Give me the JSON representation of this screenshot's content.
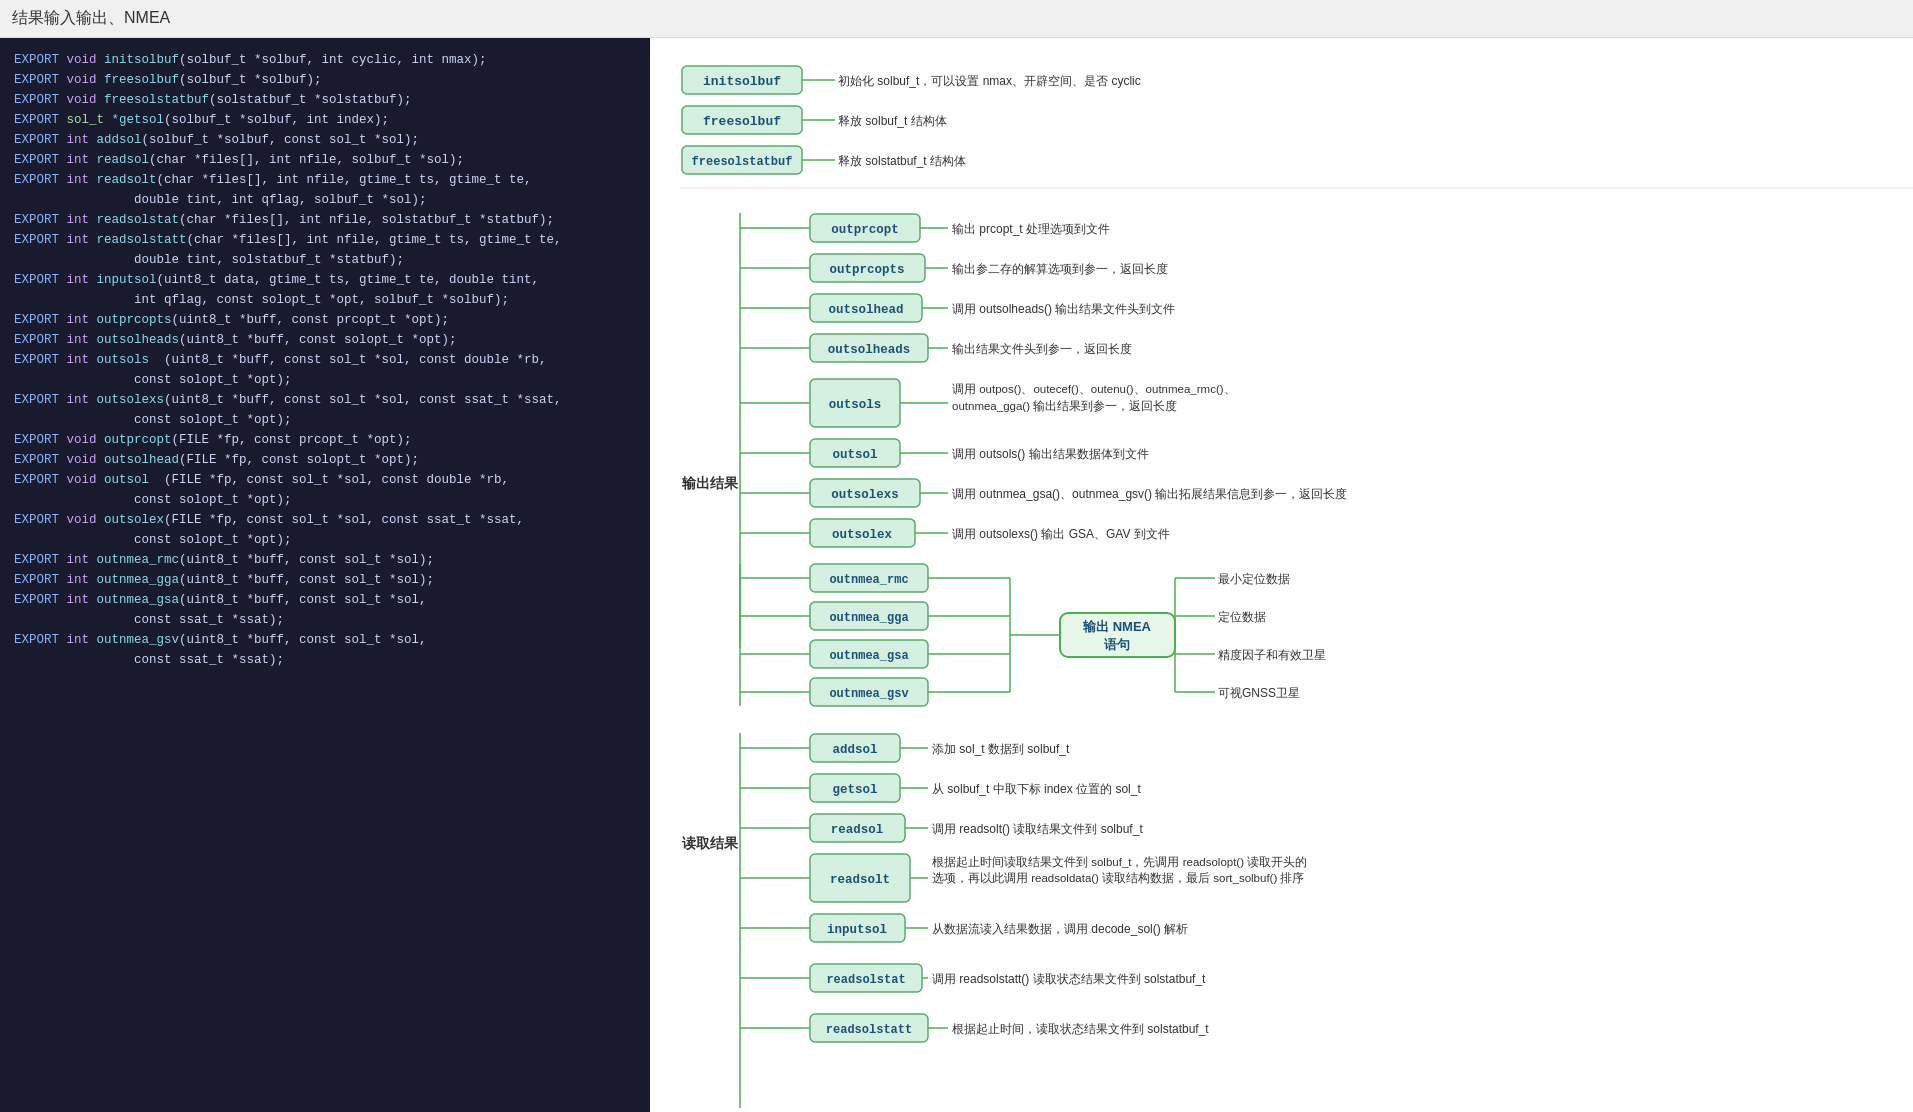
{
  "title": "结果输入输出、NMEA",
  "code_lines": [
    {
      "parts": [
        {
          "text": "EXPORT",
          "cls": "kw-export"
        },
        {
          "text": " void ",
          "cls": "kw-void"
        },
        {
          "text": "initsolbuf",
          "cls": "fn-name"
        },
        {
          "text": "(solbuf_t *solbuf, int cyclic, int nmax);",
          "cls": "punctuation"
        }
      ]
    },
    {
      "parts": [
        {
          "text": "EXPORT",
          "cls": "kw-export"
        },
        {
          "text": " void ",
          "cls": "kw-void"
        },
        {
          "text": "freesolbuf",
          "cls": "fn-name"
        },
        {
          "text": "(solbuf_t *solbuf);",
          "cls": "punctuation"
        }
      ]
    },
    {
      "parts": [
        {
          "text": "EXPORT",
          "cls": "kw-export"
        },
        {
          "text": " void ",
          "cls": "kw-void"
        },
        {
          "text": "freesolstatbuf",
          "cls": "fn-name"
        },
        {
          "text": "(solstatbuf_t *solstatbuf);",
          "cls": "punctuation"
        }
      ]
    },
    {
      "parts": [
        {
          "text": "EXPORT",
          "cls": "kw-export"
        },
        {
          "text": " sol_t ",
          "cls": "param-type"
        },
        {
          "text": "*getsol",
          "cls": "fn-name"
        },
        {
          "text": "(solbuf_t *solbuf, int index);",
          "cls": "punctuation"
        }
      ]
    },
    {
      "parts": [
        {
          "text": "EXPORT",
          "cls": "kw-export"
        },
        {
          "text": " int ",
          "cls": "kw-int"
        },
        {
          "text": "addsol",
          "cls": "fn-name"
        },
        {
          "text": "(solbuf_t *solbuf, const sol_t *sol);",
          "cls": "punctuation"
        }
      ]
    },
    {
      "parts": [
        {
          "text": "EXPORT",
          "cls": "kw-export"
        },
        {
          "text": " int ",
          "cls": "kw-int"
        },
        {
          "text": "readsol",
          "cls": "fn-name"
        },
        {
          "text": "(char *files[], int nfile, solbuf_t *sol);",
          "cls": "punctuation"
        }
      ]
    },
    {
      "parts": [
        {
          "text": "EXPORT",
          "cls": "kw-export"
        },
        {
          "text": " int ",
          "cls": "kw-int"
        },
        {
          "text": "readsolt",
          "cls": "fn-name"
        },
        {
          "text": "(char *files[], int nfile, gtime_t ts, gtime_t te,",
          "cls": "punctuation"
        }
      ]
    },
    {
      "parts": [
        {
          "text": "                double tint, int qflag, solbuf_t *sol);",
          "cls": "punctuation"
        }
      ]
    },
    {
      "parts": [
        {
          "text": "EXPORT",
          "cls": "kw-export"
        },
        {
          "text": " int ",
          "cls": "kw-int"
        },
        {
          "text": "readsolstat",
          "cls": "fn-name"
        },
        {
          "text": "(char *files[], int nfile, solstatbuf_t *statbuf);",
          "cls": "punctuation"
        }
      ]
    },
    {
      "parts": [
        {
          "text": "EXPORT",
          "cls": "kw-export"
        },
        {
          "text": " int ",
          "cls": "kw-int"
        },
        {
          "text": "readsolstatt",
          "cls": "fn-name"
        },
        {
          "text": "(char *files[], int nfile, gtime_t ts, gtime_t te,",
          "cls": "punctuation"
        }
      ]
    },
    {
      "parts": [
        {
          "text": "                double tint, solstatbuf_t *statbuf);",
          "cls": "punctuation"
        }
      ]
    },
    {
      "parts": [
        {
          "text": "EXPORT",
          "cls": "kw-export"
        },
        {
          "text": " int ",
          "cls": "kw-int"
        },
        {
          "text": "inputsol",
          "cls": "fn-name"
        },
        {
          "text": "(uint8_t data, gtime_t ts, gtime_t te, double tint,",
          "cls": "punctuation"
        }
      ]
    },
    {
      "parts": [
        {
          "text": "                int qflag, const solopt_t *opt, solbuf_t *solbuf);",
          "cls": "punctuation"
        }
      ]
    },
    {
      "parts": [
        {
          "text": "",
          "cls": ""
        }
      ]
    },
    {
      "parts": [
        {
          "text": "EXPORT",
          "cls": "kw-export"
        },
        {
          "text": " int ",
          "cls": "kw-int"
        },
        {
          "text": "outprcopts",
          "cls": "fn-name"
        },
        {
          "text": "(uint8_t *buff, const prcopt_t *opt);",
          "cls": "punctuation"
        }
      ]
    },
    {
      "parts": [
        {
          "text": "EXPORT",
          "cls": "kw-export"
        },
        {
          "text": " int ",
          "cls": "kw-int"
        },
        {
          "text": "outsolheads",
          "cls": "fn-name"
        },
        {
          "text": "(uint8_t *buff, const solopt_t *opt);",
          "cls": "punctuation"
        }
      ]
    },
    {
      "parts": [
        {
          "text": "EXPORT",
          "cls": "kw-export"
        },
        {
          "text": " int ",
          "cls": "kw-int"
        },
        {
          "text": "outsols",
          "cls": "fn-name"
        },
        {
          "text": "  (uint8_t *buff, const sol_t *sol, const double *rb,",
          "cls": "punctuation"
        }
      ]
    },
    {
      "parts": [
        {
          "text": "                const solopt_t *opt);",
          "cls": "punctuation"
        }
      ]
    },
    {
      "parts": [
        {
          "text": "EXPORT",
          "cls": "kw-export"
        },
        {
          "text": " int ",
          "cls": "kw-int"
        },
        {
          "text": "outsolexs",
          "cls": "fn-name"
        },
        {
          "text": "(uint8_t *buff, const sol_t *sol, const ssat_t *ssat,",
          "cls": "punctuation"
        }
      ]
    },
    {
      "parts": [
        {
          "text": "                const solopt_t *opt);",
          "cls": "punctuation"
        }
      ]
    },
    {
      "parts": [
        {
          "text": "EXPORT",
          "cls": "kw-export"
        },
        {
          "text": " void ",
          "cls": "kw-void"
        },
        {
          "text": "outprcopt",
          "cls": "fn-name"
        },
        {
          "text": "(FILE *fp, const prcopt_t *opt);",
          "cls": "punctuation"
        }
      ]
    },
    {
      "parts": [
        {
          "text": "EXPORT",
          "cls": "kw-export"
        },
        {
          "text": " void ",
          "cls": "kw-void"
        },
        {
          "text": "outsolhead",
          "cls": "fn-name"
        },
        {
          "text": "(FILE *fp, const solopt_t *opt);",
          "cls": "punctuation"
        }
      ]
    },
    {
      "parts": [
        {
          "text": "EXPORT",
          "cls": "kw-export"
        },
        {
          "text": " void ",
          "cls": "kw-void"
        },
        {
          "text": "outsol",
          "cls": "fn-name"
        },
        {
          "text": "  (FILE *fp, const sol_t *sol, const double *rb,",
          "cls": "punctuation"
        }
      ]
    },
    {
      "parts": [
        {
          "text": "                const solopt_t *opt);",
          "cls": "punctuation"
        }
      ]
    },
    {
      "parts": [
        {
          "text": "EXPORT",
          "cls": "kw-export"
        },
        {
          "text": " void ",
          "cls": "kw-void"
        },
        {
          "text": "outsolex",
          "cls": "fn-name"
        },
        {
          "text": "(FILE *fp, const sol_t *sol, const ssat_t *ssat,",
          "cls": "punctuation"
        }
      ]
    },
    {
      "parts": [
        {
          "text": "                const solopt_t *opt);",
          "cls": "punctuation"
        }
      ]
    },
    {
      "parts": [
        {
          "text": "EXPORT",
          "cls": "kw-export"
        },
        {
          "text": " int ",
          "cls": "kw-int"
        },
        {
          "text": "outnmea_rmc",
          "cls": "fn-name"
        },
        {
          "text": "(uint8_t *buff, const sol_t *sol);",
          "cls": "punctuation"
        }
      ]
    },
    {
      "parts": [
        {
          "text": "EXPORT",
          "cls": "kw-export"
        },
        {
          "text": " int ",
          "cls": "kw-int"
        },
        {
          "text": "outnmea_gga",
          "cls": "fn-name"
        },
        {
          "text": "(uint8_t *buff, const sol_t *sol);",
          "cls": "punctuation"
        }
      ]
    },
    {
      "parts": [
        {
          "text": "EXPORT",
          "cls": "kw-export"
        },
        {
          "text": " int ",
          "cls": "kw-int"
        },
        {
          "text": "outnmea_gsa",
          "cls": "fn-name"
        },
        {
          "text": "(uint8_t *buff, const sol_t *sol,",
          "cls": "punctuation"
        }
      ]
    },
    {
      "parts": [
        {
          "text": "                const ssat_t *ssat);",
          "cls": "punctuation"
        }
      ]
    },
    {
      "parts": [
        {
          "text": "EXPORT",
          "cls": "kw-export"
        },
        {
          "text": " int ",
          "cls": "kw-int"
        },
        {
          "text": "outnmea_gsv",
          "cls": "fn-name"
        },
        {
          "text": "(uint8_t *buff, const sol_t *sol,",
          "cls": "punctuation"
        }
      ]
    },
    {
      "parts": [
        {
          "text": "                const ssat_t *ssat);",
          "cls": "punctuation"
        }
      ]
    }
  ],
  "diagram": {
    "top_nodes": [
      {
        "id": "initsolbuf",
        "label": "initsolbuf",
        "desc": "初始化 solbuf_t，可以设置 nmax、开辟空间、是否 cyclic"
      },
      {
        "id": "freesolbuf",
        "label": "freesolbuf",
        "desc": "释放 solbuf_t 结构体"
      },
      {
        "id": "freesolstatbuf",
        "label": "freesolstatbuf",
        "desc": "释放 solstatbuf_t 结构体"
      }
    ],
    "category_output": "输出结果",
    "category_read": "读取结果",
    "output_nodes": [
      {
        "id": "outprcopt",
        "label": "outprcopt",
        "desc": "输出 prcopt_t 处理选项到文件"
      },
      {
        "id": "outprcopts",
        "label": "outprcopts",
        "desc": "输出参二存的解算选项到参一，返回长度"
      },
      {
        "id": "outsolhead",
        "label": "outsolhead",
        "desc": "调用 outsolheads() 输出结果文件头到文件"
      },
      {
        "id": "outsolheads",
        "label": "outsolheads",
        "desc": "输出结果文件头到参一，返回长度"
      },
      {
        "id": "outsols",
        "label": "outsols",
        "desc": "调用 outpos()、outecef()、outenu()、outnmea_rmc()、outnmea_gga() 输出结果到参一，返回长度"
      },
      {
        "id": "outsol",
        "label": "outsol",
        "desc": "调用 outsols() 输出结果数据体到文件"
      },
      {
        "id": "outsolexs",
        "label": "outsolexs",
        "desc": "调用 outnmea_gsa()、outnmea_gsv() 输出拓展结果信息到参一，返回长度"
      },
      {
        "id": "outsolex",
        "label": "outsolex",
        "desc": "调用 outsolexs() 输出 GSA、GAV 到文件"
      },
      {
        "id": "outnmea_rmc",
        "label": "outnmea_rmc",
        "nmea_desc": "最小定位数据"
      },
      {
        "id": "outnmea_gga",
        "label": "outnmea_gga",
        "nmea_desc": "定位数据"
      },
      {
        "id": "outnmea_gsa",
        "label": "outnmea_gsa",
        "nmea_desc": "精度因子和有效卫星"
      },
      {
        "id": "outnmea_gsv",
        "label": "outnmea_gsv",
        "nmea_desc": "可视GNSS卫星"
      }
    ],
    "nmea_group_label": "输出 NMEA 语句",
    "read_nodes": [
      {
        "id": "addsol",
        "label": "addsol",
        "desc": "添加 sol_t 数据到 solbuf_t"
      },
      {
        "id": "getsol",
        "label": "getsol",
        "desc": "从 solbuf_t 中取下标 index 位置的 sol_t"
      },
      {
        "id": "readsol",
        "label": "readsol",
        "desc": "调用 readsolt() 读取结果文件到 solbuf_t"
      },
      {
        "id": "readsolt",
        "label": "readsolt",
        "desc": "根据起止时间读取结果文件到 solbuf_t，先调用 readsolopt() 读取开头的选项，再以此调用 readsoldata() 读取结构数据，最后 sort_solbuf() 排序"
      },
      {
        "id": "inputsol",
        "label": "inputsol",
        "desc": "从数据流读入结果数据，调用 decode_sol() 解析"
      },
      {
        "id": "readsolstat",
        "label": "readsolstat",
        "desc": "调用 readsolstatt() 读取状态结果文件到 solstatbuf_t"
      },
      {
        "id": "readsolstatt",
        "label": "readsolstatt",
        "desc": "根据起止时间，读取状态结果文件到 solstatbuf_t"
      }
    ]
  }
}
